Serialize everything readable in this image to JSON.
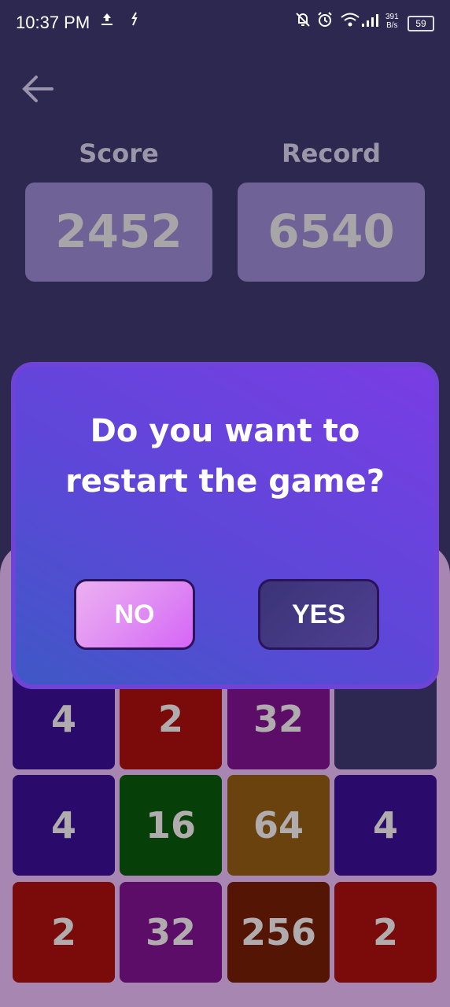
{
  "status_bar": {
    "time": "10:37 PM",
    "net_speed": "391",
    "net_unit": "B/s",
    "battery": "59"
  },
  "scores": {
    "score_label": "Score",
    "score_value": "2452",
    "record_label": "Record",
    "record_value": "6540"
  },
  "board": {
    "tiles": [
      {
        "value": "4",
        "color": "#2a0b6b"
      },
      {
        "value": "2",
        "color": "#7a0b0a"
      },
      {
        "value": "32",
        "color": "#5b0d67"
      },
      {
        "value": "",
        "color": "#2c2852"
      },
      {
        "value": "4",
        "color": "#2a0b6b"
      },
      {
        "value": "16",
        "color": "#063f08"
      },
      {
        "value": "64",
        "color": "#6a420d"
      },
      {
        "value": "4",
        "color": "#2a0b6b"
      },
      {
        "value": "2",
        "color": "#7a0b0a"
      },
      {
        "value": "32",
        "color": "#5b0d67"
      },
      {
        "value": "256",
        "color": "#551505"
      },
      {
        "value": "2",
        "color": "#7a0b0a"
      }
    ]
  },
  "dialog": {
    "line1": "Do you want to",
    "line2": "restart the game?",
    "no_label": "NO",
    "yes_label": "YES"
  },
  "icons": [
    "upload-icon",
    "sync-icon",
    "bell-off-icon",
    "alarm-icon",
    "wifi-icon",
    "signal-icon",
    "battery-icon",
    "back-arrow-icon"
  ]
}
